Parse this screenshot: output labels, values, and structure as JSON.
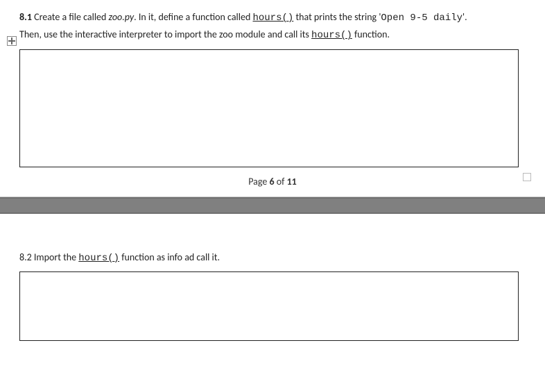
{
  "q81": {
    "number": "8.1",
    "text_part1": " Create a file called ",
    "filename": "zoo.py",
    "text_part2": ". In it, define a function called ",
    "func1": "hours()",
    "text_part3": " that prints the string '",
    "code_string": "Open 9-5 daily",
    "text_part4": "'.",
    "line2_part1": "Then, use the interactive interpreter to import the zoo module and call its ",
    "func2": "hours()",
    "line2_part2": " function."
  },
  "footer": {
    "prefix": "Page ",
    "current": "6",
    "middle": " of ",
    "total": "11"
  },
  "q82": {
    "number": "8.2",
    "text_part1": " Import the ",
    "func": "hours()",
    "text_part2": " function as info ad call it."
  }
}
